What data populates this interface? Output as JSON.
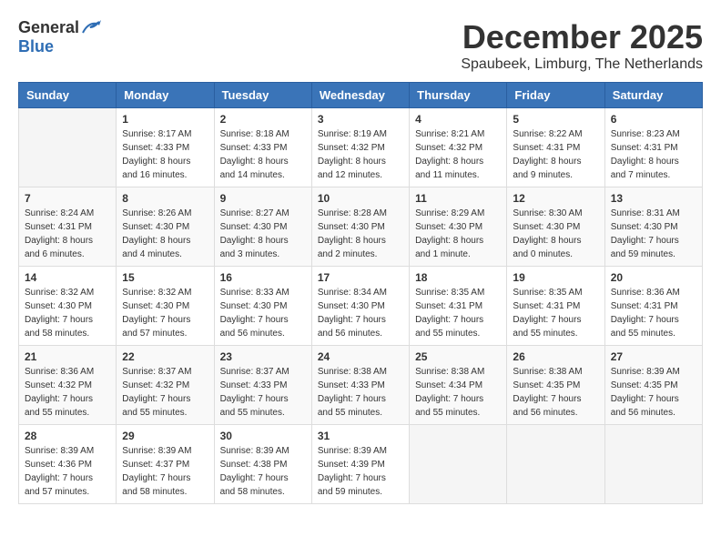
{
  "logo": {
    "general": "General",
    "blue": "Blue"
  },
  "title": {
    "month": "December 2025",
    "location": "Spaubeek, Limburg, The Netherlands"
  },
  "headers": [
    "Sunday",
    "Monday",
    "Tuesday",
    "Wednesday",
    "Thursday",
    "Friday",
    "Saturday"
  ],
  "weeks": [
    [
      {
        "day": "",
        "info": ""
      },
      {
        "day": "1",
        "info": "Sunrise: 8:17 AM\nSunset: 4:33 PM\nDaylight: 8 hours\nand 16 minutes."
      },
      {
        "day": "2",
        "info": "Sunrise: 8:18 AM\nSunset: 4:33 PM\nDaylight: 8 hours\nand 14 minutes."
      },
      {
        "day": "3",
        "info": "Sunrise: 8:19 AM\nSunset: 4:32 PM\nDaylight: 8 hours\nand 12 minutes."
      },
      {
        "day": "4",
        "info": "Sunrise: 8:21 AM\nSunset: 4:32 PM\nDaylight: 8 hours\nand 11 minutes."
      },
      {
        "day": "5",
        "info": "Sunrise: 8:22 AM\nSunset: 4:31 PM\nDaylight: 8 hours\nand 9 minutes."
      },
      {
        "day": "6",
        "info": "Sunrise: 8:23 AM\nSunset: 4:31 PM\nDaylight: 8 hours\nand 7 minutes."
      }
    ],
    [
      {
        "day": "7",
        "info": "Sunrise: 8:24 AM\nSunset: 4:31 PM\nDaylight: 8 hours\nand 6 minutes."
      },
      {
        "day": "8",
        "info": "Sunrise: 8:26 AM\nSunset: 4:30 PM\nDaylight: 8 hours\nand 4 minutes."
      },
      {
        "day": "9",
        "info": "Sunrise: 8:27 AM\nSunset: 4:30 PM\nDaylight: 8 hours\nand 3 minutes."
      },
      {
        "day": "10",
        "info": "Sunrise: 8:28 AM\nSunset: 4:30 PM\nDaylight: 8 hours\nand 2 minutes."
      },
      {
        "day": "11",
        "info": "Sunrise: 8:29 AM\nSunset: 4:30 PM\nDaylight: 8 hours\nand 1 minute."
      },
      {
        "day": "12",
        "info": "Sunrise: 8:30 AM\nSunset: 4:30 PM\nDaylight: 8 hours\nand 0 minutes."
      },
      {
        "day": "13",
        "info": "Sunrise: 8:31 AM\nSunset: 4:30 PM\nDaylight: 7 hours\nand 59 minutes."
      }
    ],
    [
      {
        "day": "14",
        "info": "Sunrise: 8:32 AM\nSunset: 4:30 PM\nDaylight: 7 hours\nand 58 minutes."
      },
      {
        "day": "15",
        "info": "Sunrise: 8:32 AM\nSunset: 4:30 PM\nDaylight: 7 hours\nand 57 minutes."
      },
      {
        "day": "16",
        "info": "Sunrise: 8:33 AM\nSunset: 4:30 PM\nDaylight: 7 hours\nand 56 minutes."
      },
      {
        "day": "17",
        "info": "Sunrise: 8:34 AM\nSunset: 4:30 PM\nDaylight: 7 hours\nand 56 minutes."
      },
      {
        "day": "18",
        "info": "Sunrise: 8:35 AM\nSunset: 4:31 PM\nDaylight: 7 hours\nand 55 minutes."
      },
      {
        "day": "19",
        "info": "Sunrise: 8:35 AM\nSunset: 4:31 PM\nDaylight: 7 hours\nand 55 minutes."
      },
      {
        "day": "20",
        "info": "Sunrise: 8:36 AM\nSunset: 4:31 PM\nDaylight: 7 hours\nand 55 minutes."
      }
    ],
    [
      {
        "day": "21",
        "info": "Sunrise: 8:36 AM\nSunset: 4:32 PM\nDaylight: 7 hours\nand 55 minutes."
      },
      {
        "day": "22",
        "info": "Sunrise: 8:37 AM\nSunset: 4:32 PM\nDaylight: 7 hours\nand 55 minutes."
      },
      {
        "day": "23",
        "info": "Sunrise: 8:37 AM\nSunset: 4:33 PM\nDaylight: 7 hours\nand 55 minutes."
      },
      {
        "day": "24",
        "info": "Sunrise: 8:38 AM\nSunset: 4:33 PM\nDaylight: 7 hours\nand 55 minutes."
      },
      {
        "day": "25",
        "info": "Sunrise: 8:38 AM\nSunset: 4:34 PM\nDaylight: 7 hours\nand 55 minutes."
      },
      {
        "day": "26",
        "info": "Sunrise: 8:38 AM\nSunset: 4:35 PM\nDaylight: 7 hours\nand 56 minutes."
      },
      {
        "day": "27",
        "info": "Sunrise: 8:39 AM\nSunset: 4:35 PM\nDaylight: 7 hours\nand 56 minutes."
      }
    ],
    [
      {
        "day": "28",
        "info": "Sunrise: 8:39 AM\nSunset: 4:36 PM\nDaylight: 7 hours\nand 57 minutes."
      },
      {
        "day": "29",
        "info": "Sunrise: 8:39 AM\nSunset: 4:37 PM\nDaylight: 7 hours\nand 58 minutes."
      },
      {
        "day": "30",
        "info": "Sunrise: 8:39 AM\nSunset: 4:38 PM\nDaylight: 7 hours\nand 58 minutes."
      },
      {
        "day": "31",
        "info": "Sunrise: 8:39 AM\nSunset: 4:39 PM\nDaylight: 7 hours\nand 59 minutes."
      },
      {
        "day": "",
        "info": ""
      },
      {
        "day": "",
        "info": ""
      },
      {
        "day": "",
        "info": ""
      }
    ]
  ]
}
